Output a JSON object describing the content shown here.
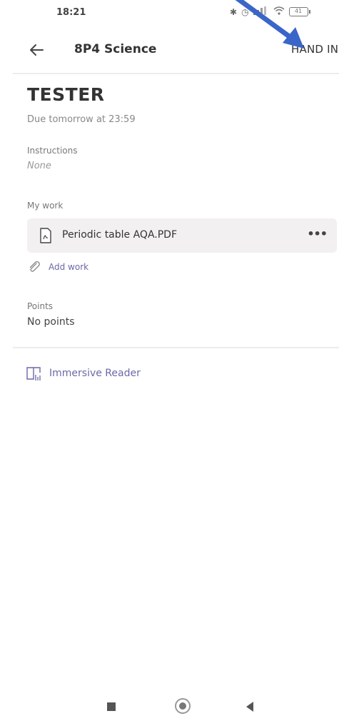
{
  "status_bar": {
    "time": "18:21",
    "battery": "41"
  },
  "header": {
    "title": "8P4 Science",
    "hand_in_label": "HAND IN",
    "back_icon": "arrow-left-icon"
  },
  "assignment": {
    "title": "TESTER",
    "due": "Due tomorrow at 23:59",
    "instructions_label": "Instructions",
    "instructions_value": "None",
    "my_work_label": "My work",
    "file": {
      "name": "Periodic table AQA.PDF",
      "icon": "pdf-file-icon",
      "more_label": "•••"
    },
    "add_work_label": "Add work",
    "points_label": "Points",
    "points_value": "No points",
    "immersive_reader_label": "Immersive Reader"
  },
  "colors": {
    "accent": "#6b68a8",
    "annotation_arrow": "#3a66c9",
    "file_row_bg": "#f2f0f0"
  }
}
